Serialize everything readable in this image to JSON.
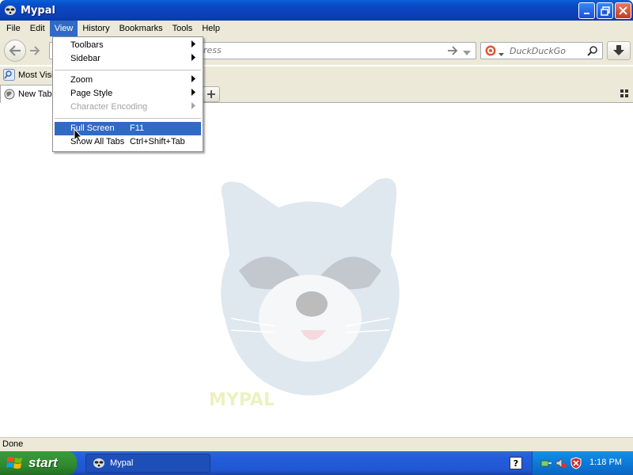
{
  "window": {
    "title": "Mypal"
  },
  "menubar": {
    "items": [
      {
        "label": "File"
      },
      {
        "label": "Edit"
      },
      {
        "label": "View"
      },
      {
        "label": "History"
      },
      {
        "label": "Bookmarks"
      },
      {
        "label": "Tools"
      },
      {
        "label": "Help"
      }
    ],
    "active_index": 2
  },
  "navbar": {
    "url_placeholder": "ress",
    "search_engine": "DuckDuckGo"
  },
  "bookmarks": {
    "items": [
      {
        "label": "Most Visit"
      }
    ]
  },
  "tabs": {
    "items": [
      {
        "label": "New Tab"
      }
    ]
  },
  "view_menu": {
    "items": [
      {
        "label": "Toolbars",
        "submenu": true
      },
      {
        "label": "Sidebar",
        "submenu": true
      },
      {
        "label": "Zoom",
        "submenu": true
      },
      {
        "label": "Page Style",
        "submenu": true
      },
      {
        "label": "Character Encoding",
        "submenu": true,
        "disabled": true
      },
      {
        "label": "Full Screen",
        "shortcut": "F11",
        "highlighted": true
      },
      {
        "label": "Show All Tabs",
        "shortcut": "Ctrl+Shift+Tab"
      }
    ]
  },
  "content": {
    "logo_text": "MYPAL"
  },
  "statusbar": {
    "text": "Done"
  },
  "taskbar": {
    "start_label": "start",
    "task_label": "Mypal",
    "clock": "1:18 PM"
  },
  "colors": {
    "titlebar": "#0a4fc8",
    "menu_highlight": "#316ac5",
    "chrome": "#ece9d8",
    "taskbar": "#245edc",
    "start": "#2f8a2f"
  }
}
